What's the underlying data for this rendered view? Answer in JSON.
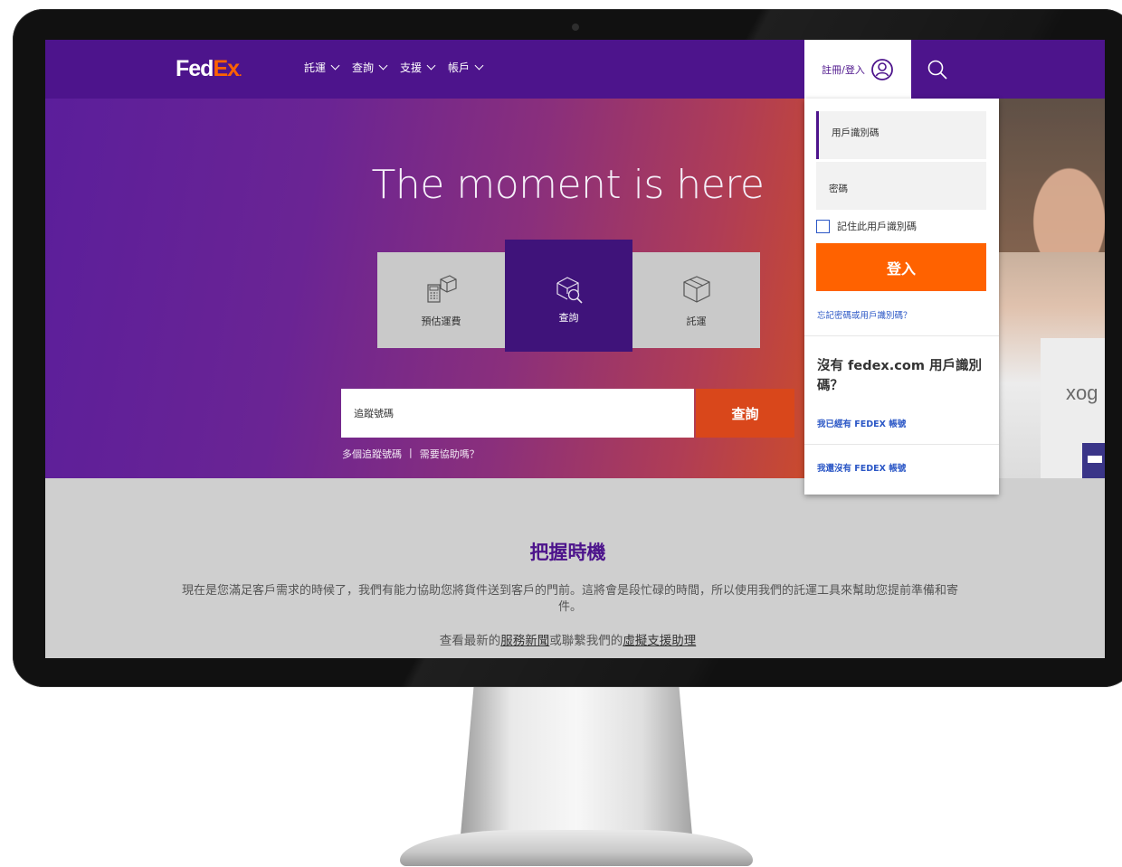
{
  "brand": {
    "name_part1": "Fed",
    "name_part2": "Ex",
    "dot": "."
  },
  "nav": {
    "items": [
      {
        "label": "託運"
      },
      {
        "label": "查詢"
      },
      {
        "label": "支援"
      },
      {
        "label": "帳戶"
      }
    ],
    "login_label": "註冊/登入",
    "icons": {
      "user": "user-circle-icon",
      "search": "search-icon",
      "chevron": "chevron-down-icon"
    }
  },
  "hero": {
    "title": "The moment is here",
    "tiles": [
      {
        "label": "預估運費",
        "icon": "rate-calculator-icon",
        "active": false
      },
      {
        "label": "查詢",
        "icon": "track-box-icon",
        "active": true
      },
      {
        "label": "託運",
        "icon": "ship-box-icon",
        "active": false
      }
    ],
    "tracking": {
      "placeholder": "追蹤號碼",
      "button": "查詢",
      "link_multiple": "多個追蹤號碼",
      "separator": "|",
      "link_help": "需要協助嗎？"
    },
    "photo_box_text": "xog"
  },
  "info": {
    "heading": "把握時機",
    "body": "現在是您滿足客戶需求的時候了，我們有能力協助您將貨件送到客戶的門前。這將會是段忙碌的時間，所以使用我們的託運工具來幫助您提前準備和寄件。",
    "links_prefix": "查看最新的",
    "link_news": "服務新聞",
    "links_middle": "或聯繫我們的",
    "link_assistant": "虛擬支援助理"
  },
  "login_panel": {
    "userid_label": "用戶識別碼",
    "password_label": "密碼",
    "remember_label": "記住此用戶識別碼",
    "remember_checked": false,
    "login_button": "登入",
    "forgot_link": "忘記密碼或用戶識別碼？",
    "no_id_text": "沒有 fedex.com 用戶識別碼？",
    "have_account_link": "我已經有 FEDEX 帳號",
    "no_account_link": "我還沒有 FEDEX 帳號"
  },
  "colors": {
    "brand_purple": "#4d148c",
    "brand_orange": "#ff6200",
    "track_button": "#d9471b",
    "link_blue": "#2b57c6"
  }
}
